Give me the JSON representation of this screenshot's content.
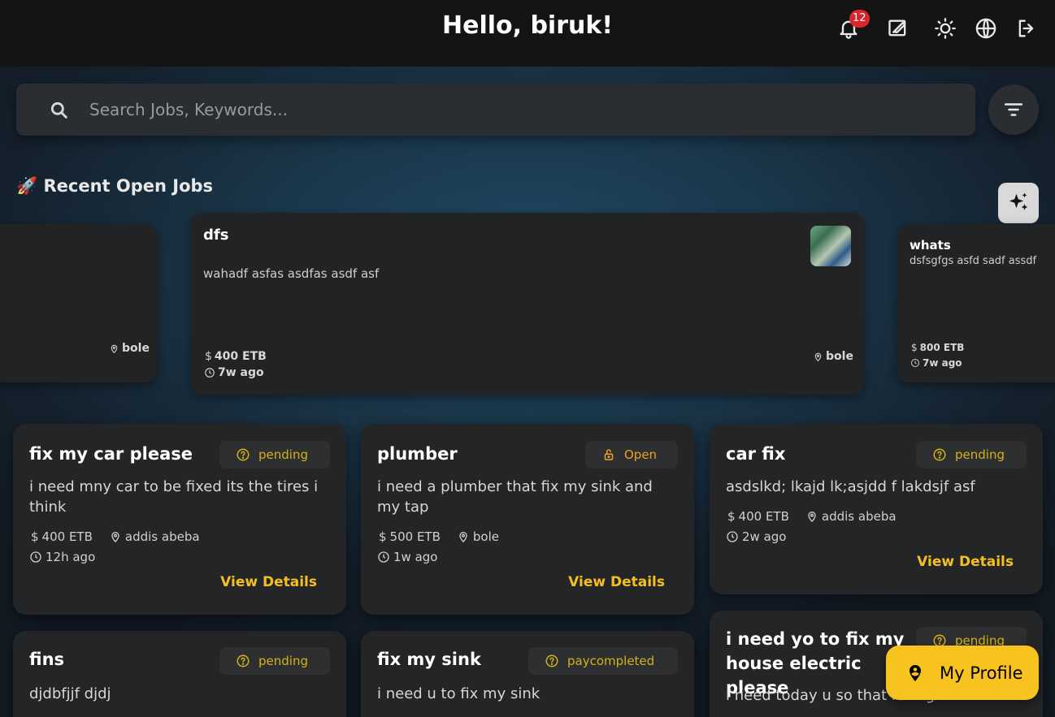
{
  "header": {
    "greeting": "Hello, biruk!",
    "notification_count": "12"
  },
  "search": {
    "placeholder": "Search Jobs, Keywords..."
  },
  "recent": {
    "title": "🚀 Recent Open Jobs",
    "cards": [
      {
        "title": "",
        "description": "",
        "price": "",
        "location": "bole",
        "time": ""
      },
      {
        "title": "dfs",
        "description": "wahadf  asfas  asdfas asdf asf",
        "price": "400 ETB",
        "location": "bole",
        "time": "7w ago"
      },
      {
        "title": "whats",
        "description": "dsfsgfgs asfd sadf assdf",
        "price": "800 ETB",
        "location": "",
        "time": "7w ago"
      }
    ]
  },
  "jobs": [
    {
      "title": "fix my car please",
      "status": "pending",
      "description": "i need mny car to be fixed its  the tires i think",
      "price": "400 ETB",
      "location": "addis abeba",
      "time": "12h ago",
      "action": "View Details"
    },
    {
      "title": "plumber",
      "status": "Open",
      "description": "i need  a plumber that fix my sink and my tap",
      "price": "500 ETB",
      "location": "bole",
      "time": "1w ago",
      "action": "View Details"
    },
    {
      "title": "car fix",
      "status": "pending",
      "description": "asdslkd; lkajd  lk;asjdd f lakdsjf asf",
      "price": "400 ETB",
      "location": "addis abeba",
      "time": "2w ago",
      "action": "View Details"
    },
    {
      "title": "fins",
      "status": "pending",
      "description": "djdbfjjf djdj"
    },
    {
      "title": "fix my sink",
      "status": "paycompleted",
      "description": "i need u to fix my sink"
    },
    {
      "title": "i need yo to fix my house electric please",
      "status": "pending",
      "description": "i need today u so that rating"
    }
  ],
  "profile_button": {
    "label": "My Profile"
  },
  "colors": {
    "accent": "#f8c21f",
    "pending": "#d4b21b",
    "open": "#f0a020",
    "paycompleted": "#d4b21b",
    "badge": "#d8252e"
  }
}
